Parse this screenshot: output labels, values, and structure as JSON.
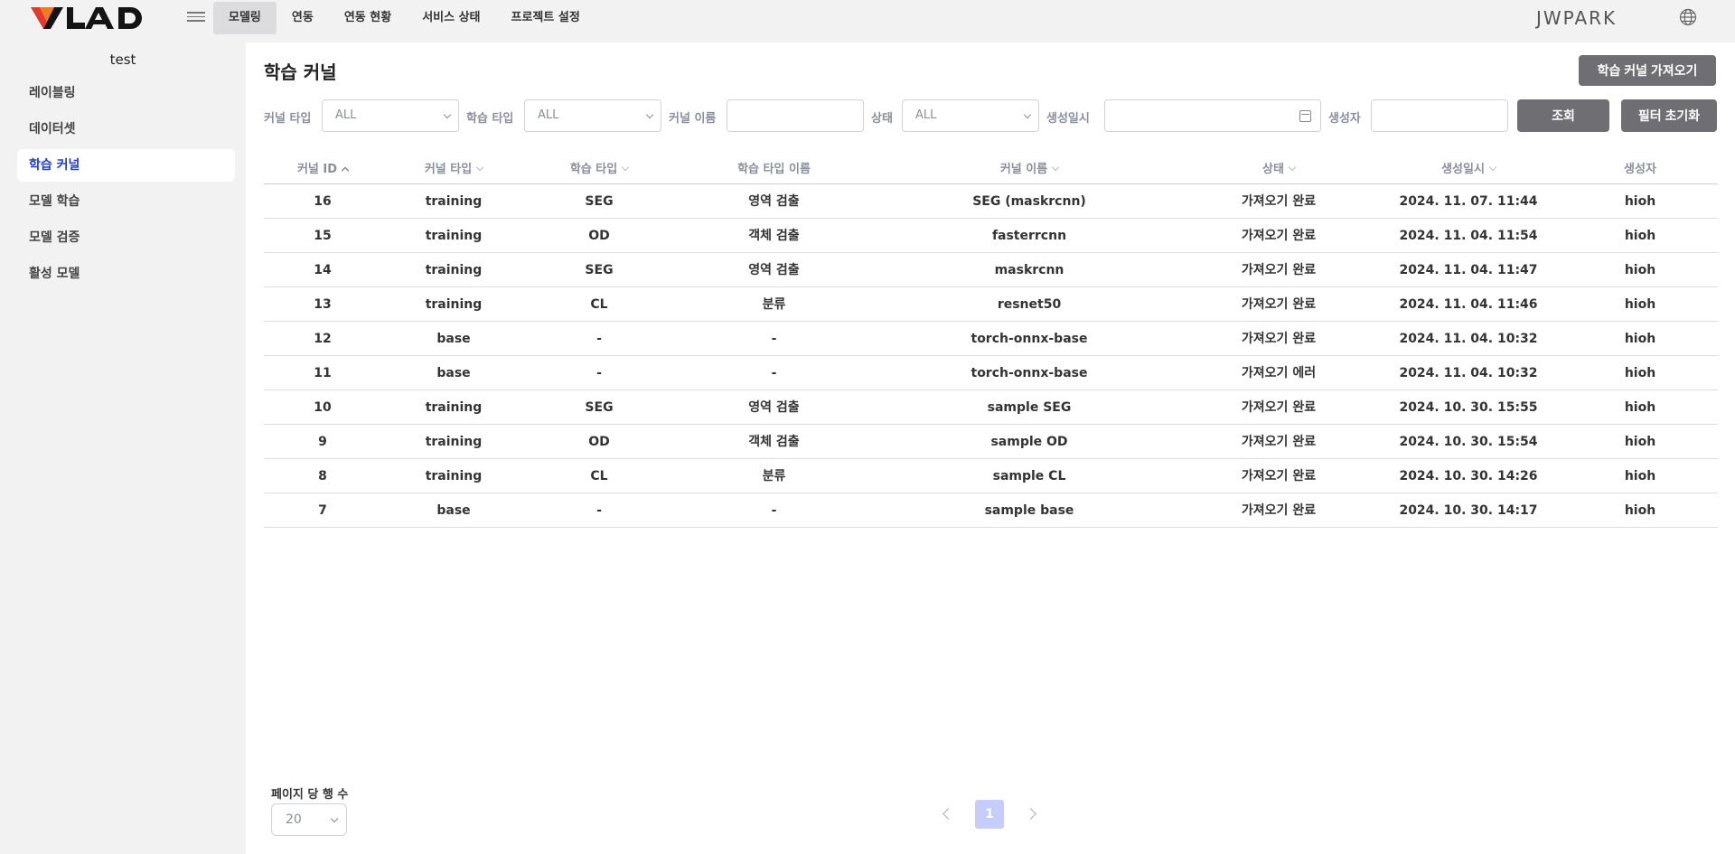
{
  "header": {
    "nav": [
      "모델링",
      "연동",
      "연동 현황",
      "서비스 상태",
      "프로젝트 설정"
    ],
    "user_name": "JWPARK"
  },
  "sidebar": {
    "project_name": "test",
    "items": [
      "레이블링",
      "데이터셋",
      "학습 커널",
      "모델 학습",
      "모델 검증",
      "활성 모델"
    ]
  },
  "page": {
    "title": "학습 커널",
    "import_button": "학습 커널 가져오기"
  },
  "filters": {
    "kernel_type_label": "커널 타입",
    "kernel_type_value": "ALL",
    "train_type_label": "학습 타입",
    "train_type_value": "ALL",
    "kernel_name_label": "커널 이름",
    "status_label": "상태",
    "status_value": "ALL",
    "created_date_label": "생성일시",
    "creator_label": "생성자",
    "search_button": "조회",
    "reset_button": "필터 초기화"
  },
  "table": {
    "columns": [
      "커널 ID",
      "커널 타입",
      "학습 타입",
      "학습 타입 이름",
      "커널 이름",
      "상태",
      "생성일시",
      "생성자"
    ],
    "rows": [
      [
        "16",
        "training",
        "SEG",
        "영역 검출",
        "SEG (maskrcnn)",
        "가져오기 완료",
        "2024. 11. 07. 11:44",
        "hioh"
      ],
      [
        "15",
        "training",
        "OD",
        "객체 검출",
        "fasterrcnn",
        "가져오기 완료",
        "2024. 11. 04. 11:54",
        "hioh"
      ],
      [
        "14",
        "training",
        "SEG",
        "영역 검출",
        "maskrcnn",
        "가져오기 완료",
        "2024. 11. 04. 11:47",
        "hioh"
      ],
      [
        "13",
        "training",
        "CL",
        "분류",
        "resnet50",
        "가져오기 완료",
        "2024. 11. 04. 11:46",
        "hioh"
      ],
      [
        "12",
        "base",
        "-",
        "-",
        "torch-onnx-base",
        "가져오기 완료",
        "2024. 11. 04. 10:32",
        "hioh"
      ],
      [
        "11",
        "base",
        "-",
        "-",
        "torch-onnx-base",
        "가져오기 에러",
        "2024. 11. 04. 10:32",
        "hioh"
      ],
      [
        "10",
        "training",
        "SEG",
        "영역 검출",
        "sample SEG",
        "가져오기 완료",
        "2024. 10. 30. 15:55",
        "hioh"
      ],
      [
        "9",
        "training",
        "OD",
        "객체 검출",
        "sample OD",
        "가져오기 완료",
        "2024. 10. 30. 15:54",
        "hioh"
      ],
      [
        "8",
        "training",
        "CL",
        "분류",
        "sample CL",
        "가져오기 완료",
        "2024. 10. 30. 14:26",
        "hioh"
      ],
      [
        "7",
        "base",
        "-",
        "-",
        "sample base",
        "가져오기 완료",
        "2024. 10. 30. 14:17",
        "hioh"
      ]
    ]
  },
  "pagination": {
    "rows_per_page_label": "페이지 당 행 수",
    "rows_per_page_value": "20",
    "current_page": "1"
  }
}
